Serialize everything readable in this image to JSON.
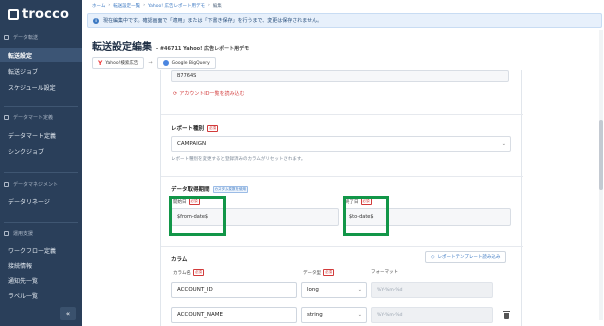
{
  "sidebar": {
    "logo": "trocco",
    "sections": [
      {
        "label": "データ転送"
      },
      {
        "label": "データマート定義"
      },
      {
        "label": "データマネジメント"
      },
      {
        "label": "運用支援"
      }
    ],
    "items": [
      {
        "label": "転送設定"
      },
      {
        "label": "転送ジョブ"
      },
      {
        "label": "スケジュール設定"
      },
      {
        "label": "データマート定義"
      },
      {
        "label": "シンクジョブ"
      },
      {
        "label": "データリネージ"
      },
      {
        "label": "ワークフロー定義"
      },
      {
        "label": "接続情報"
      },
      {
        "label": "通知先一覧"
      },
      {
        "label": "ラベル一覧"
      }
    ],
    "collapse_label": "«"
  },
  "breadcrumb": [
    "ホーム",
    "転送設定一覧",
    "Yahoo! 広告レポート用デモ",
    "編集"
  ],
  "notice": "現在編集中です。確認画面で「適用」または「下書き保存」を行うまで、変更は保存されません。",
  "page": {
    "title": "転送設定編集",
    "subtitle": "- #46711 Yahoo! 広告レポート用デモ",
    "source_chip": "Yahoo!検索広告",
    "dest_chip": "Google BigQuery"
  },
  "form": {
    "account_value": "B7764S",
    "load_accounts_link": "アカウントID一覧を読み込む",
    "report_type_label": "レポート種別",
    "report_type_value": "CAMPAIGN",
    "report_type_help": "レポート種別を変更すると登録済みのカラムがリセットされます。",
    "period_label": "データ取得期間",
    "period_tag": "カスタム変数を使用",
    "start_label": "開始日",
    "start_value": "$from-date$",
    "end_label": "終了日",
    "end_value": "$to-date$",
    "required": "必須",
    "columns_label": "カラム",
    "template_button": "レポートテンプレート読み込み",
    "headers": {
      "name": "カラム名",
      "type": "データ型",
      "format": "フォーマット"
    },
    "rows": [
      {
        "name": "ACCOUNT_ID",
        "type": "long",
        "format": "%Y-%m-%d"
      },
      {
        "name": "ACCOUNT_NAME",
        "type": "string",
        "format": "%Y-%m-%d"
      }
    ]
  },
  "colors": {
    "sidebar_bg": "#2a3f5a",
    "highlight": "#129648",
    "required": "#d23b3b",
    "link": "#3b78c2"
  }
}
